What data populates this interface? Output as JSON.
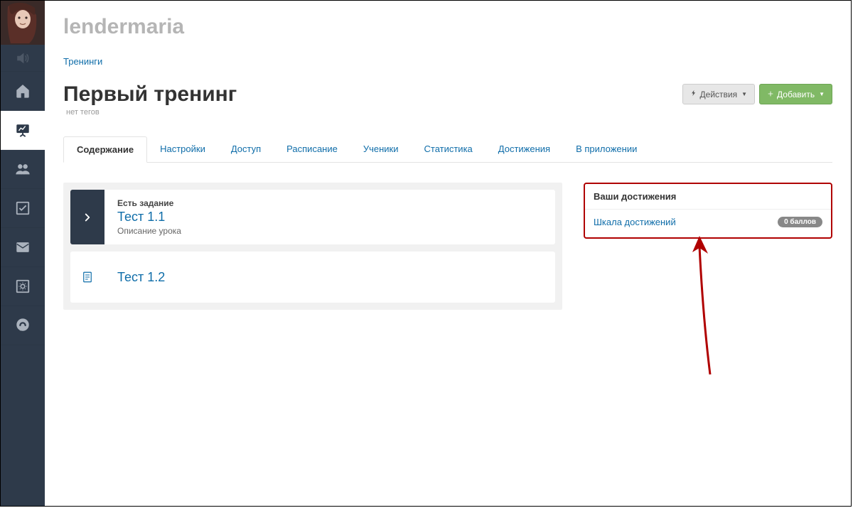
{
  "brand": "lendermaria",
  "breadcrumb": "Тренинги",
  "pageTitle": "Первый тренинг",
  "tagsText": "нет тегов",
  "buttons": {
    "actions": "Действия",
    "add": "Добавить"
  },
  "tabs": [
    "Содержание",
    "Настройки",
    "Доступ",
    "Расписание",
    "Ученики",
    "Статистика",
    "Достижения",
    "В приложении"
  ],
  "lessons": {
    "l1": {
      "badge": "Есть задание",
      "name": "Тест 1.1",
      "desc": "Описание урока"
    },
    "l2": {
      "name": "Тест 1.2"
    }
  },
  "achievements": {
    "title": "Ваши достижения",
    "scaleLink": "Шкала достижений",
    "score": "0 баллов"
  }
}
